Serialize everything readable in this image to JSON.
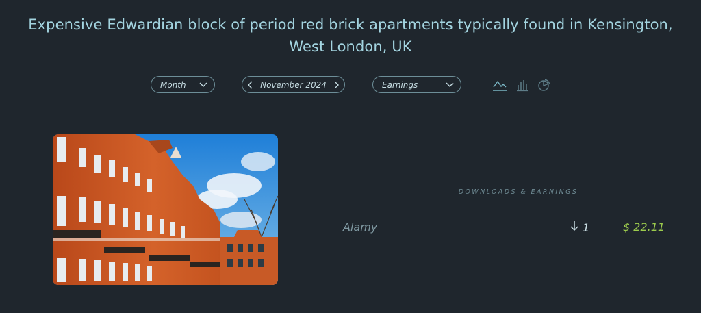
{
  "header": {
    "title_line1": "Expensive Edwardian block of period red brick apartments typically found in Kensington,",
    "title_line2": "West London, UK"
  },
  "filters": {
    "period": {
      "selected": "Month",
      "icon": "chevron-down-icon"
    },
    "date": {
      "value": "November 2024",
      "prev_icon": "chevron-left-icon",
      "next_icon": "chevron-right-icon"
    },
    "metric": {
      "selected": "Earnings",
      "icon": "chevron-down-icon"
    }
  },
  "chart_types": [
    {
      "name": "line-chart-icon",
      "active": true
    },
    {
      "name": "bar-chart-icon",
      "active": false
    },
    {
      "name": "pie-chart-icon",
      "active": false
    }
  ],
  "image": {
    "subject": "red brick Edwardian apartment block under blue sky"
  },
  "stats": {
    "section_label": "DOWNLOADS & EARNINGS",
    "rows": [
      {
        "agency": "Alamy",
        "downloads": "1",
        "downloads_icon": "arrow-down-icon",
        "earnings": "$ 22.11"
      }
    ]
  },
  "colors": {
    "background": "#1f262d",
    "title": "#a3d4e0",
    "pill_border": "#6d8e98",
    "earnings": "#9ccb4d",
    "muted": "#6f8b94"
  }
}
